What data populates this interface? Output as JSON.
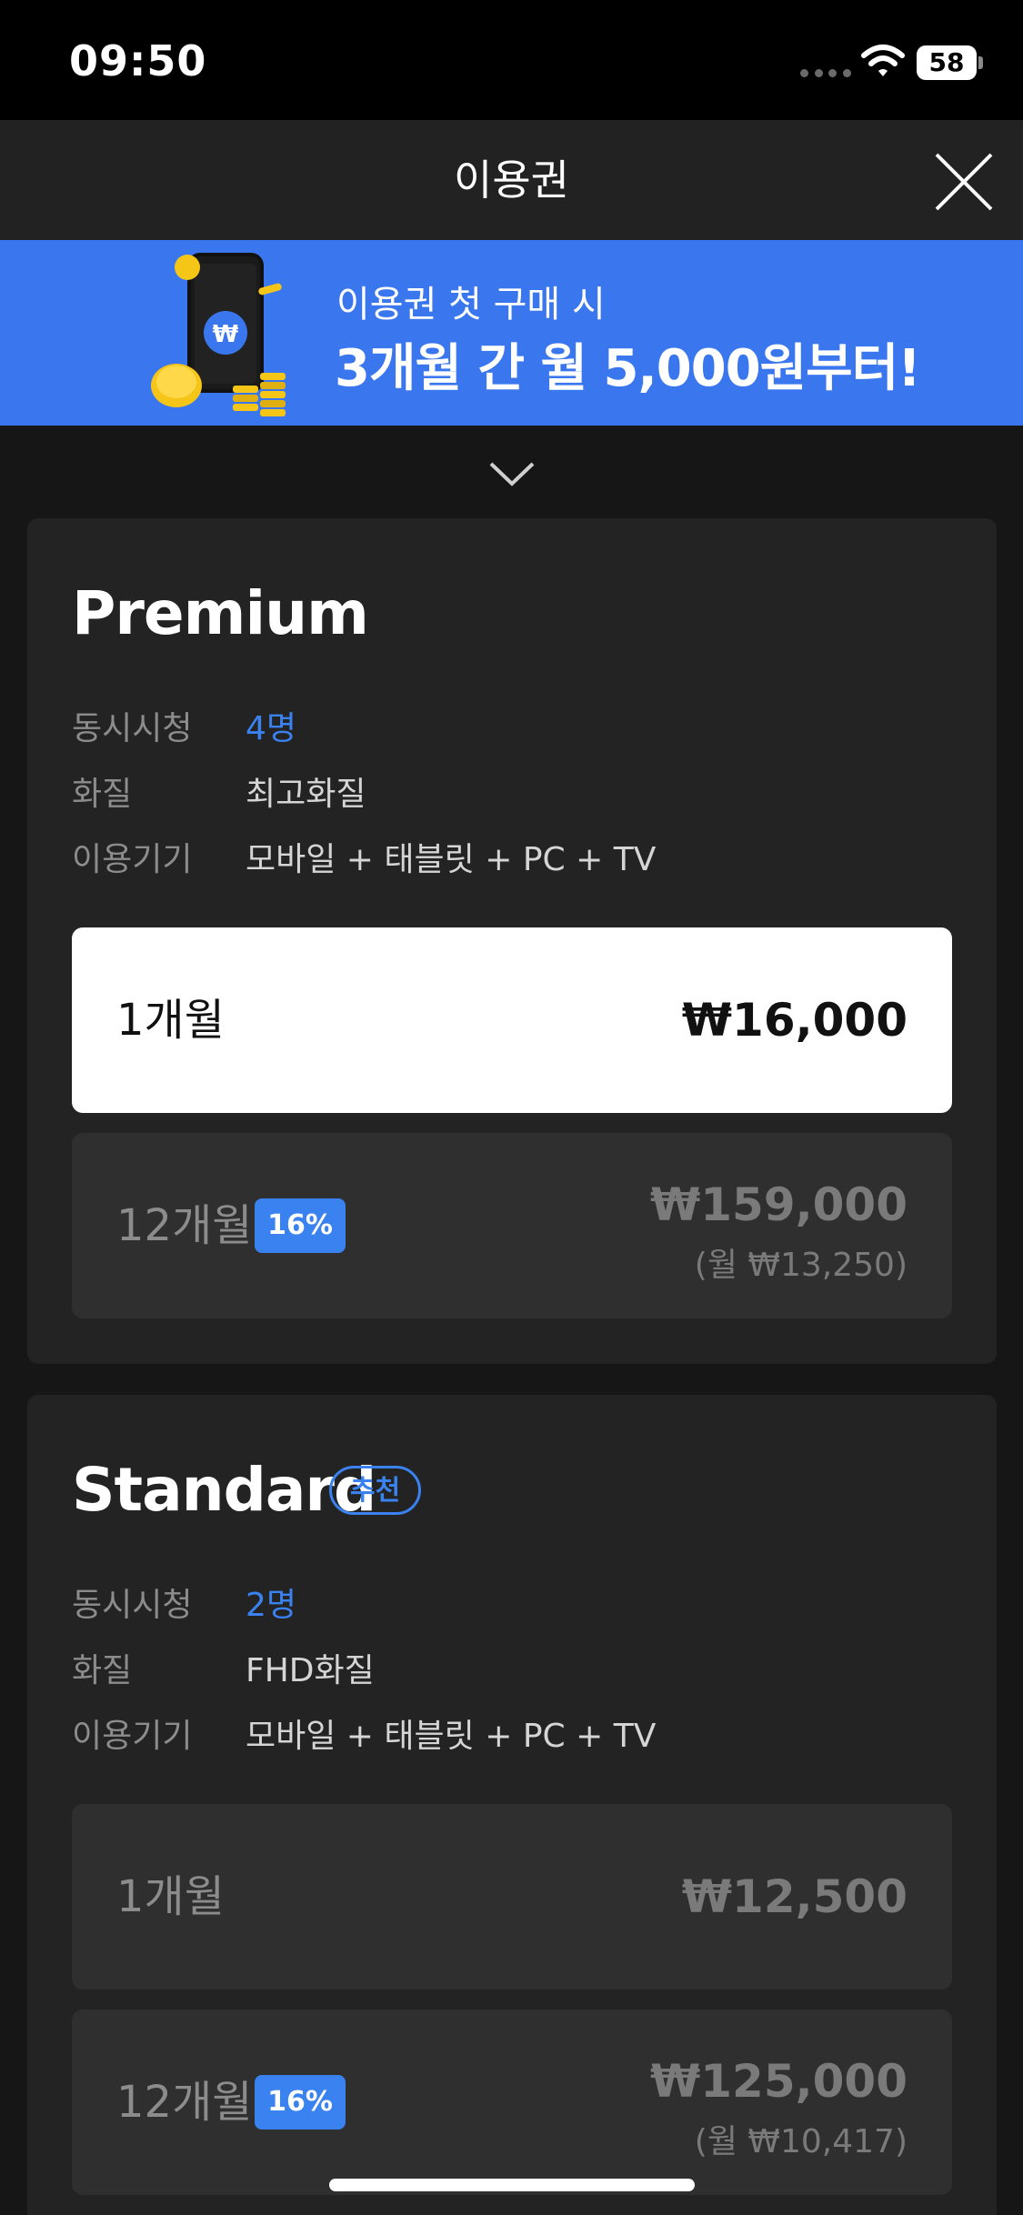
{
  "status_bar": {
    "time": "09:50",
    "battery": "58",
    "icons": [
      "signal-icon",
      "wifi-icon",
      "battery-icon"
    ]
  },
  "header": {
    "title": "이용권",
    "close_icon": "close-icon"
  },
  "promo": {
    "line1": "이용권 첫 구매 시",
    "line2": "3개월 간 월 5,000원부터!",
    "symbol": "₩",
    "colors": {
      "background": "#3a77ef"
    }
  },
  "plans": [
    {
      "name": "Premium",
      "features": [
        {
          "label": "동시시청",
          "value": "4명"
        },
        {
          "label": "화질",
          "value": "최고화질"
        },
        {
          "label": "이용기기",
          "value": "모바일 + 태블릿 + PC + TV"
        }
      ],
      "options": [
        {
          "period": "1개월",
          "price": "₩16,000",
          "selected": true
        },
        {
          "period": "12개월",
          "badge": "16%",
          "price": "₩159,000",
          "monthly": "(월 ₩13,250)"
        }
      ]
    },
    {
      "name": "Standard",
      "badge": "추천",
      "features": [
        {
          "label": "동시시청",
          "value": "2명"
        },
        {
          "label": "화질",
          "value": "FHD화질"
        },
        {
          "label": "이용기기",
          "value": "모바일 + 태블릿 + PC + TV"
        }
      ],
      "options": [
        {
          "period": "1개월",
          "price": "₩12,500"
        },
        {
          "period": "12개월",
          "badge": "16%",
          "price": "₩125,000",
          "monthly": "(월 ₩10,417)"
        }
      ]
    }
  ],
  "colors": {
    "accent": "#3a82f0",
    "background": "#161616",
    "card": "#232323",
    "option": "#2f2f2f"
  }
}
